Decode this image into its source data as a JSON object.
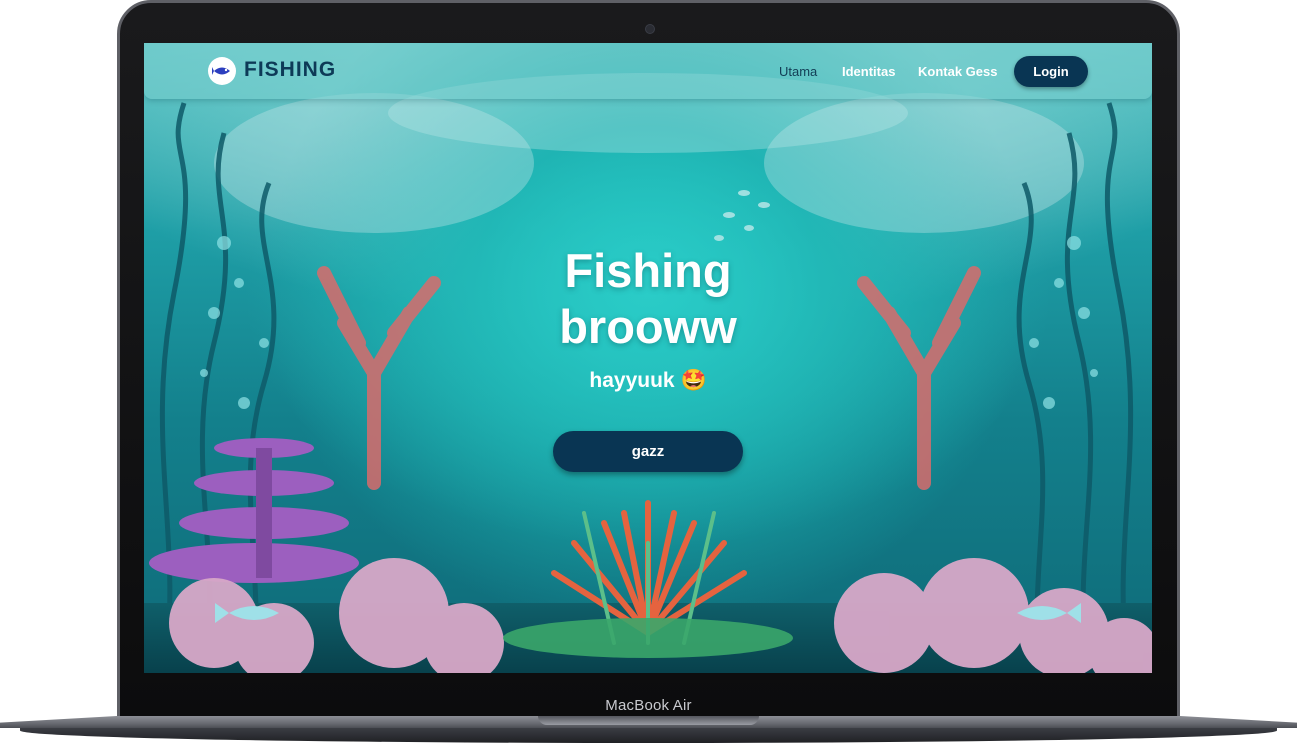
{
  "device": {
    "label": "MacBook Air"
  },
  "navbar": {
    "brand": "FISHING",
    "logo_icon": "fish-logo-icon",
    "links": [
      {
        "label": "Utama",
        "active": true
      },
      {
        "label": "Identitas",
        "active": false
      },
      {
        "label": "Kontak Gess",
        "active": false
      }
    ],
    "login_label": "Login"
  },
  "hero": {
    "title_line1": "Fishing",
    "title_line2": "brooww",
    "subtitle": "hayyuuk 🤩",
    "cta_label": "gazz"
  },
  "colors": {
    "primary_dark": "#093553",
    "brand_text": "#0d3a57",
    "water": "#1fa9ab"
  }
}
